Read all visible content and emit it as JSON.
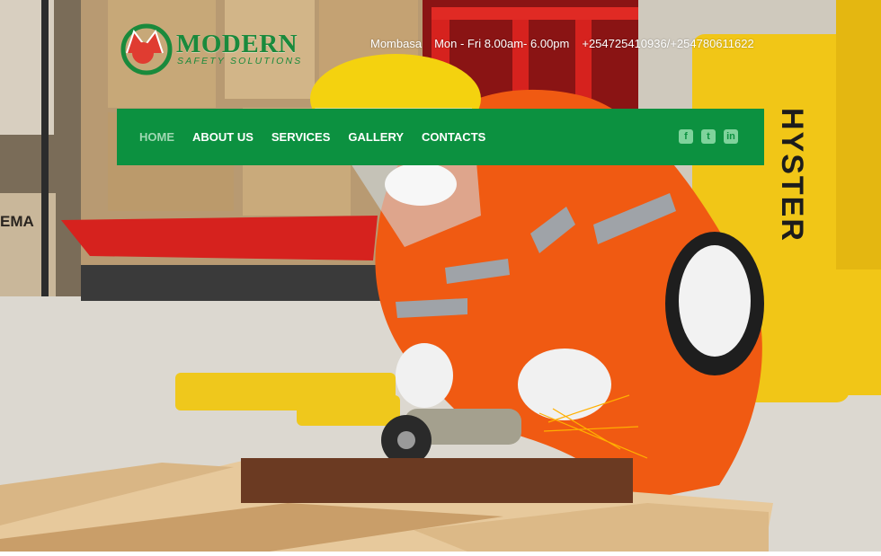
{
  "brand": {
    "name": "MODERN",
    "tagline": "SAFETY SOLUTIONS",
    "green": "#1a8a3c",
    "red": "#e03c31"
  },
  "top_info": {
    "location": "Mombasa",
    "hours": "Mon - Fri 8.00am- 6.00pm",
    "phone": "+254725410936/+254780611622"
  },
  "nav": {
    "background": "#0c9140",
    "items": [
      {
        "label": "HOME",
        "active": true
      },
      {
        "label": "ABOUT US",
        "active": false
      },
      {
        "label": "SERVICES",
        "active": false
      },
      {
        "label": "GALLERY",
        "active": false
      },
      {
        "label": "CONTACTS",
        "active": false
      }
    ]
  },
  "social": {
    "facebook": "f",
    "twitter": "t",
    "linkedin": "in"
  },
  "hero": {
    "forklift_text": "HYSTER",
    "box_text": "EMA"
  }
}
